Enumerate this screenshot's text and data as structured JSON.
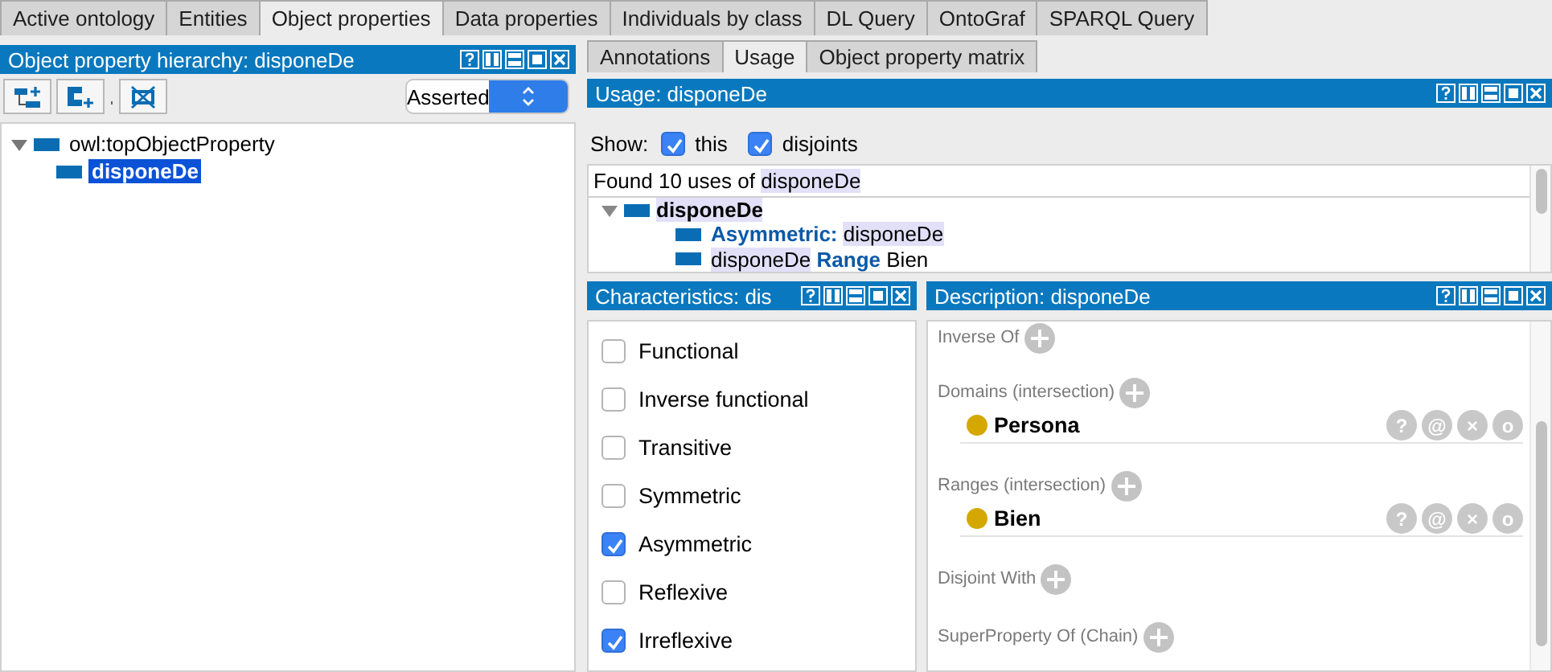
{
  "main_tabs": [
    {
      "label": "Active ontology",
      "selected": false
    },
    {
      "label": "Entities",
      "selected": false
    },
    {
      "label": "Object properties",
      "selected": true
    },
    {
      "label": "Data properties",
      "selected": false
    },
    {
      "label": "Individuals by class",
      "selected": false
    },
    {
      "label": "DL Query",
      "selected": false
    },
    {
      "label": "OntoGraf",
      "selected": false
    },
    {
      "label": "SPARQL Query",
      "selected": false
    }
  ],
  "hierarchy": {
    "title": "Object property hierarchy: disponeDe",
    "mode": "Asserted",
    "tree": [
      {
        "label": "owl:topObjectProperty",
        "expanded": true,
        "selected": false,
        "children": [
          {
            "label": "disponeDe",
            "selected": true
          }
        ]
      }
    ]
  },
  "sub_tabs": [
    {
      "label": "Annotations",
      "selected": false
    },
    {
      "label": "Usage",
      "selected": true
    },
    {
      "label": "Object property matrix",
      "selected": false
    }
  ],
  "usage": {
    "title": "Usage: disponeDe",
    "show_label": "Show:",
    "filters": [
      {
        "label": "this",
        "checked": true
      },
      {
        "label": "disjoints",
        "checked": true
      }
    ],
    "found": {
      "prefix": "Found 10 uses of",
      "entity": "disponeDe"
    },
    "tree": {
      "label": "disponeDe",
      "expanded": true,
      "children": [
        {
          "parts": [
            {
              "kind": "keyword",
              "text": "Asymmetric:"
            },
            {
              "kind": "entity",
              "text": "disponeDe"
            }
          ]
        },
        {
          "parts": [
            {
              "kind": "entity",
              "text": "disponeDe"
            },
            {
              "kind": "keyword",
              "text": "Range"
            },
            {
              "kind": "plain",
              "text": "Bien"
            }
          ]
        }
      ]
    }
  },
  "characteristics": {
    "title": "Characteristics: dis",
    "items": [
      {
        "label": "Functional",
        "checked": false
      },
      {
        "label": "Inverse functional",
        "checked": false
      },
      {
        "label": "Transitive",
        "checked": false
      },
      {
        "label": "Symmetric",
        "checked": false
      },
      {
        "label": "Asymmetric",
        "checked": true
      },
      {
        "label": "Reflexive",
        "checked": false
      },
      {
        "label": "Irreflexive",
        "checked": true
      }
    ]
  },
  "description": {
    "title": "Description: disponeDe",
    "sections": [
      {
        "label": "Inverse Of"
      },
      {
        "label": "Domains (intersection)",
        "items": [
          {
            "label": "Persona",
            "actions": [
              "?",
              "@",
              "×",
              "o"
            ]
          }
        ]
      },
      {
        "label": "Ranges (intersection)",
        "items": [
          {
            "label": "Bien",
            "actions": [
              "?",
              "@",
              "×",
              "o"
            ]
          }
        ]
      },
      {
        "label": "Disjoint With"
      },
      {
        "label": "SuperProperty Of (Chain)"
      }
    ]
  }
}
